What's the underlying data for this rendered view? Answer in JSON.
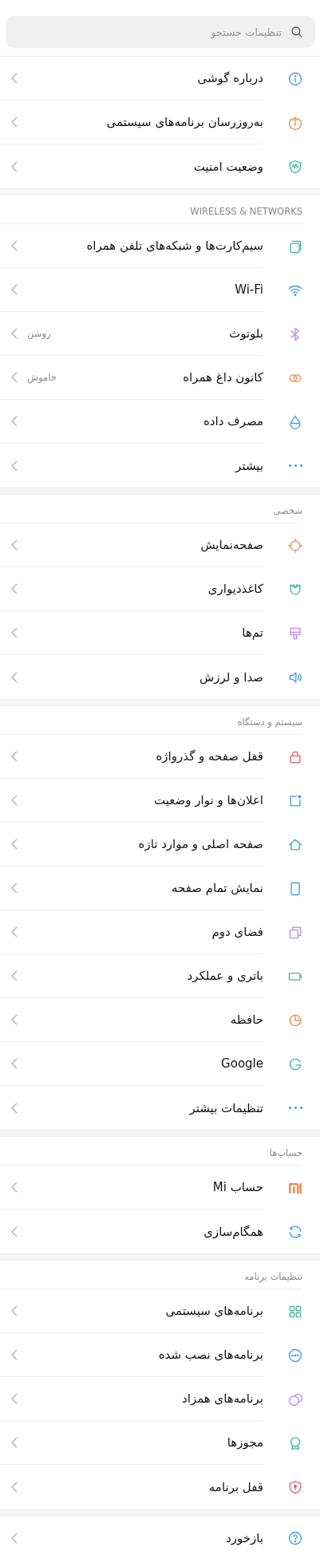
{
  "search": {
    "placeholder": "تنظیمات جستجو"
  },
  "sections": [
    {
      "items": [
        {
          "kind": "info",
          "label": "درباره گوشی"
        },
        {
          "kind": "update",
          "label": "به‌روزرسان برنامه‌های سیستمی"
        },
        {
          "kind": "shield",
          "label": "وضعیت امنیت"
        }
      ]
    },
    {
      "header": "WIRELESS & NETWORKS",
      "items": [
        {
          "kind": "sim",
          "label": "سیم‌کارت‌ها و شبکه‌های تلفن همراه"
        },
        {
          "kind": "wifi",
          "label": "Wi-Fi"
        },
        {
          "kind": "bluetooth",
          "label": "بلوتوث",
          "value": "روشن"
        },
        {
          "kind": "hotspot",
          "label": "کانون داغ همراه",
          "value": "خاموش"
        },
        {
          "kind": "drop",
          "label": "مصرف داده"
        },
        {
          "kind": "dots",
          "label": "بیشتر"
        }
      ]
    },
    {
      "header": "شخصی",
      "items": [
        {
          "kind": "sun",
          "label": "صفحه‌نمایش"
        },
        {
          "kind": "tulip",
          "label": "کاغذدیواری"
        },
        {
          "kind": "brush",
          "label": "تم‌ها"
        },
        {
          "kind": "speaker",
          "label": "صدا و لرزش"
        }
      ]
    },
    {
      "header": "سیستم و دستگاه",
      "items": [
        {
          "kind": "lock",
          "label": "قفل صفحه و گذرواژه"
        },
        {
          "kind": "notify",
          "label": "اعلان‌ها و نوار وضعیت"
        },
        {
          "kind": "home",
          "label": "صفحه اصلی و موارد تازه"
        },
        {
          "kind": "phone",
          "label": "نمایش تمام صفحه"
        },
        {
          "kind": "copies",
          "label": "فضای دوم"
        },
        {
          "kind": "battery",
          "label": "باتری و عملکرد"
        },
        {
          "kind": "pie",
          "label": "حافظه"
        },
        {
          "kind": "g",
          "label": "Google"
        },
        {
          "kind": "dots",
          "label": "تنظیمات بیشتر"
        }
      ]
    },
    {
      "header": "حساب‌ها",
      "items": [
        {
          "kind": "mi",
          "label": "حساب Mi"
        },
        {
          "kind": "sync",
          "label": "همگام‌سازی"
        }
      ]
    },
    {
      "header": "تنظیمات برنامه",
      "items": [
        {
          "kind": "grid",
          "label": "برنامه‌های سیستمی"
        },
        {
          "kind": "circledots",
          "label": "برنامه‌های نصب شده"
        },
        {
          "kind": "rings",
          "label": "برنامه‌های همزاد"
        },
        {
          "kind": "award",
          "label": "مجوزها"
        },
        {
          "kind": "shieldlock",
          "label": "قفل برنامه"
        }
      ]
    },
    {
      "items": [
        {
          "kind": "help",
          "label": "بازخورد"
        }
      ]
    }
  ]
}
